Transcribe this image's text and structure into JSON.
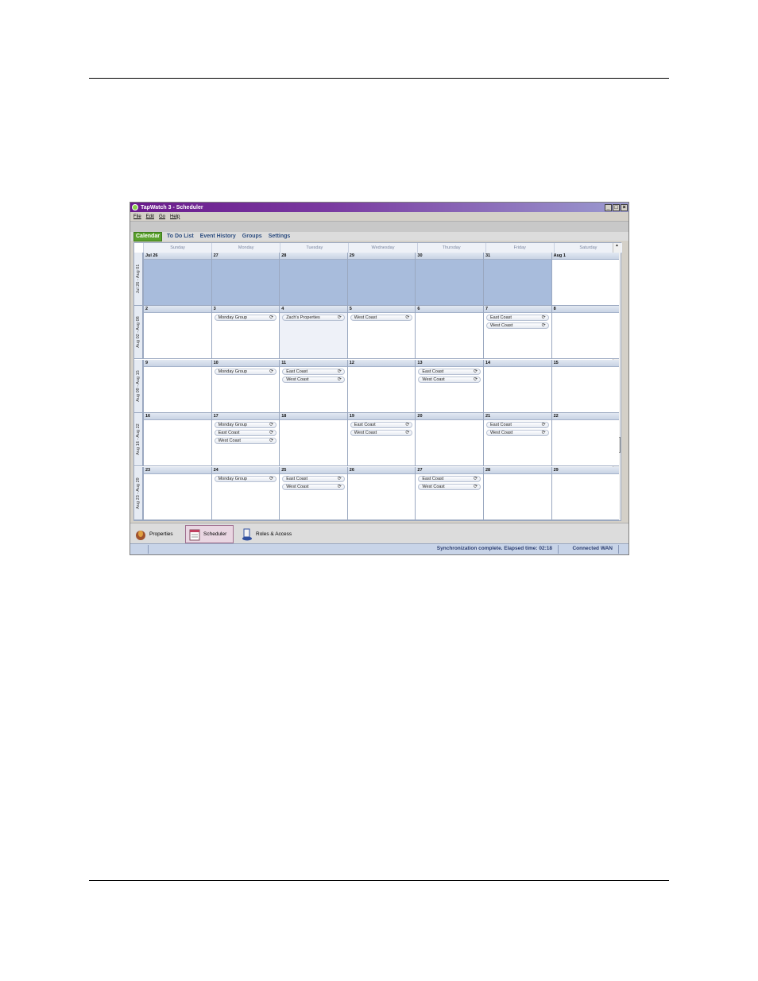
{
  "window": {
    "title": "TapWatch 3 - Scheduler",
    "controls": [
      "_",
      "□",
      "×"
    ]
  },
  "menu": [
    "File",
    "Edit",
    "Go",
    "Help"
  ],
  "tabs": [
    {
      "label": "Calendar",
      "active": true
    },
    {
      "label": "To Do List",
      "active": false
    },
    {
      "label": "Event History",
      "active": false
    },
    {
      "label": "Groups",
      "active": false
    },
    {
      "label": "Settings",
      "active": false
    }
  ],
  "day_headers": [
    "Sunday",
    "Monday",
    "Tuesday",
    "Wednesday",
    "Thursday",
    "Friday",
    "Saturday"
  ],
  "weeks": [
    {
      "label": "Jul 26 - Aug 01",
      "days": [
        {
          "num": "Jul 26",
          "state": "past",
          "events": []
        },
        {
          "num": "27",
          "state": "past",
          "events": []
        },
        {
          "num": "28",
          "state": "past",
          "events": []
        },
        {
          "num": "29",
          "state": "past",
          "events": []
        },
        {
          "num": "30",
          "state": "past",
          "events": []
        },
        {
          "num": "31",
          "state": "past",
          "events": []
        },
        {
          "num": "Aug 1",
          "state": "normal",
          "events": []
        }
      ]
    },
    {
      "label": "Aug 02 - Aug 08",
      "days": [
        {
          "num": "2",
          "state": "normal",
          "events": []
        },
        {
          "num": "3",
          "state": "normal",
          "events": [
            "Monday Group"
          ]
        },
        {
          "num": "4",
          "state": "today",
          "events": [
            "Zach's Properties"
          ]
        },
        {
          "num": "5",
          "state": "normal",
          "events": [
            "West Coast"
          ]
        },
        {
          "num": "6",
          "state": "normal",
          "events": []
        },
        {
          "num": "7",
          "state": "normal",
          "events": [
            "East Coast",
            "West Coast"
          ]
        },
        {
          "num": "8",
          "state": "normal",
          "events": []
        }
      ]
    },
    {
      "label": "Aug 09 - Aug 15",
      "days": [
        {
          "num": "9",
          "state": "normal",
          "events": []
        },
        {
          "num": "10",
          "state": "normal",
          "events": [
            "Monday Group"
          ]
        },
        {
          "num": "11",
          "state": "normal",
          "events": [
            "East Coast",
            "West Coast"
          ]
        },
        {
          "num": "12",
          "state": "normal",
          "events": []
        },
        {
          "num": "13",
          "state": "normal",
          "events": [
            "East Coast",
            "West Coast"
          ]
        },
        {
          "num": "14",
          "state": "normal",
          "events": []
        },
        {
          "num": "15",
          "state": "normal",
          "events": []
        }
      ]
    },
    {
      "label": "Aug 16 - Aug 22",
      "days": [
        {
          "num": "16",
          "state": "normal",
          "events": []
        },
        {
          "num": "17",
          "state": "normal",
          "events": [
            "Monday Group",
            "East Coast",
            "West Coast"
          ]
        },
        {
          "num": "18",
          "state": "normal",
          "events": []
        },
        {
          "num": "19",
          "state": "normal",
          "events": [
            "East Coast",
            "West Coast"
          ]
        },
        {
          "num": "20",
          "state": "normal",
          "events": []
        },
        {
          "num": "21",
          "state": "normal",
          "events": [
            "East Coast",
            "West Coast"
          ]
        },
        {
          "num": "22",
          "state": "normal",
          "events": []
        }
      ]
    },
    {
      "label": "Aug 23 - Aug 29",
      "days": [
        {
          "num": "23",
          "state": "normal",
          "events": []
        },
        {
          "num": "24",
          "state": "normal",
          "events": [
            "Monday Group"
          ]
        },
        {
          "num": "25",
          "state": "normal",
          "events": [
            "East Coast",
            "West Coast"
          ]
        },
        {
          "num": "26",
          "state": "normal",
          "events": []
        },
        {
          "num": "27",
          "state": "normal",
          "events": [
            "East Coast",
            "West Coast"
          ]
        },
        {
          "num": "28",
          "state": "normal",
          "events": []
        },
        {
          "num": "29",
          "state": "normal",
          "events": []
        }
      ]
    }
  ],
  "event_icon": "sync-icon",
  "nav": [
    {
      "label": "Properties",
      "icon": "properties-icon",
      "active": false
    },
    {
      "label": "Scheduler",
      "icon": "scheduler-icon",
      "active": true
    },
    {
      "label": "Roles & Access",
      "icon": "roles-access-icon",
      "active": false
    }
  ],
  "status": {
    "sync_message": "Synchronization complete. Elapsed time: 02:18",
    "connection": "Connected WAN"
  },
  "colors": {
    "title_bar": "#6a1a8c",
    "active_tab": "#5aa02c",
    "past_day": "#a8bcdc",
    "status_bar": "#c8d4e8"
  }
}
